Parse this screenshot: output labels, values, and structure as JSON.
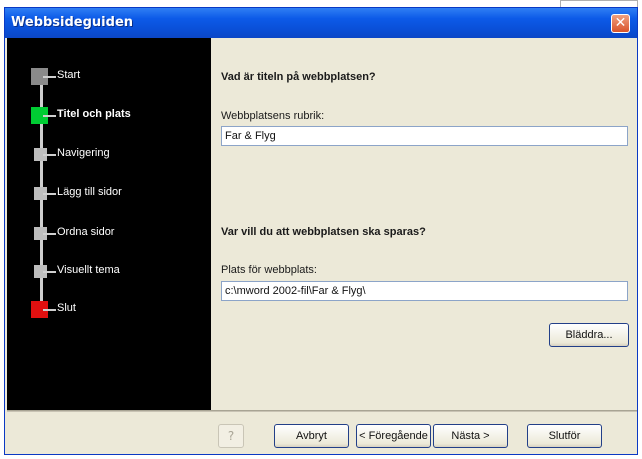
{
  "window": {
    "title": "Webbsideguiden",
    "close_glyph": "✕"
  },
  "steps": [
    {
      "label": "Start",
      "color": "#8a8a8a",
      "active": false
    },
    {
      "label": "Titel och plats",
      "color": "#00cc33",
      "active": true
    },
    {
      "label": "Navigering",
      "color": "#bdbdbd",
      "active": false
    },
    {
      "label": "Lägg till sidor",
      "color": "#bdbdbd",
      "active": false
    },
    {
      "label": "Ordna sidor",
      "color": "#bdbdbd",
      "active": false
    },
    {
      "label": "Visuellt tema",
      "color": "#bdbdbd",
      "active": false
    },
    {
      "label": "Slut",
      "color": "#e01010",
      "active": false
    }
  ],
  "title_section": {
    "question": "Vad är titeln på webbplatsen?",
    "field_label": "Webbplatsens rubrik:",
    "field_value": "Far & Flyg"
  },
  "location_section": {
    "question": "Var vill du att webbplatsen ska sparas?",
    "field_label": "Plats för webbplats:",
    "field_value": "c:\\mword 2002-fil\\Far & Flyg\\",
    "browse_label": "Bläddra..."
  },
  "footer": {
    "help_icon": "?",
    "cancel": "Avbryt",
    "previous": "< Föregående",
    "next": "Nästa >",
    "finish": "Slutför"
  }
}
